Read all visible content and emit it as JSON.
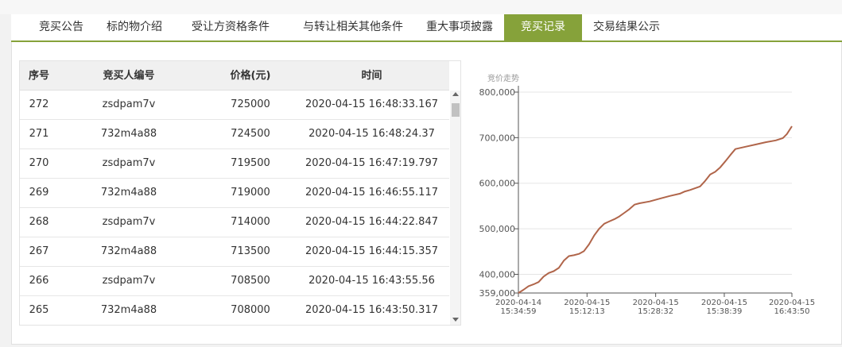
{
  "tabs": [
    {
      "label": "竞买公告",
      "active": false
    },
    {
      "label": "标的物介绍",
      "active": false
    },
    {
      "label": "受让方资格条件",
      "active": false
    },
    {
      "label": "与转让相关其他条件",
      "active": false
    },
    {
      "label": "重大事项披露",
      "active": false
    },
    {
      "label": "竞买记录",
      "active": true
    },
    {
      "label": "交易结果公示",
      "active": false
    }
  ],
  "table": {
    "headers": [
      "序号",
      "竞买人编号",
      "价格(元)",
      "时间"
    ],
    "rows": [
      [
        "272",
        "zsdpam7v",
        "725000",
        "2020-04-15 16:48:33.167"
      ],
      [
        "271",
        "732m4a88",
        "724500",
        "2020-04-15 16:48:24.37"
      ],
      [
        "270",
        "zsdpam7v",
        "719500",
        "2020-04-15 16:47:19.797"
      ],
      [
        "269",
        "732m4a88",
        "719000",
        "2020-04-15 16:46:55.117"
      ],
      [
        "268",
        "zsdpam7v",
        "714000",
        "2020-04-15 16:44:22.847"
      ],
      [
        "267",
        "732m4a88",
        "713500",
        "2020-04-15 16:44:15.357"
      ],
      [
        "266",
        "zsdpam7v",
        "708500",
        "2020-04-15 16:43:55.56"
      ],
      [
        "265",
        "732m4a88",
        "708000",
        "2020-04-15 16:43:50.317"
      ]
    ]
  },
  "chart_data": {
    "type": "line",
    "title": "竞价走势",
    "ylim": [
      359000,
      800000
    ],
    "y_ticks": [
      "359,000",
      "400,000",
      "500,000",
      "600,000",
      "700,000",
      "800,000"
    ],
    "y_tick_values": [
      359000,
      400000,
      500000,
      600000,
      700000,
      800000
    ],
    "x_ticks": [
      {
        "line1": "2020-04-14",
        "line2": "15:34:59",
        "index": 0
      },
      {
        "line1": "2020-04-15",
        "line2": "15:12:13",
        "index": 68
      },
      {
        "line1": "2020-04-15",
        "line2": "15:28:32",
        "index": 136
      },
      {
        "line1": "2020-04-15",
        "line2": "15:38:39",
        "index": 204
      },
      {
        "line1": "2020-04-15",
        "line2": "16:43:50",
        "index": 271
      }
    ],
    "series": [
      {
        "color": "#b0654a",
        "points": [
          [
            0,
            359000
          ],
          [
            5,
            366000
          ],
          [
            10,
            374000
          ],
          [
            15,
            378000
          ],
          [
            20,
            383000
          ],
          [
            25,
            395000
          ],
          [
            30,
            403000
          ],
          [
            35,
            407000
          ],
          [
            40,
            414000
          ],
          [
            45,
            430000
          ],
          [
            50,
            440000
          ],
          [
            55,
            442000
          ],
          [
            60,
            445000
          ],
          [
            65,
            451000
          ],
          [
            70,
            466000
          ],
          [
            75,
            485000
          ],
          [
            80,
            500000
          ],
          [
            85,
            511000
          ],
          [
            90,
            516000
          ],
          [
            95,
            521000
          ],
          [
            100,
            527000
          ],
          [
            105,
            535000
          ],
          [
            110,
            543000
          ],
          [
            115,
            553000
          ],
          [
            120,
            556000
          ],
          [
            130,
            560000
          ],
          [
            140,
            566000
          ],
          [
            150,
            572000
          ],
          [
            160,
            577000
          ],
          [
            165,
            582000
          ],
          [
            170,
            585000
          ],
          [
            180,
            593000
          ],
          [
            185,
            605000
          ],
          [
            190,
            619000
          ],
          [
            195,
            625000
          ],
          [
            200,
            635000
          ],
          [
            205,
            648000
          ],
          [
            210,
            662000
          ],
          [
            215,
            675000
          ],
          [
            225,
            680000
          ],
          [
            235,
            685000
          ],
          [
            245,
            690000
          ],
          [
            255,
            694000
          ],
          [
            262,
            699000
          ],
          [
            266,
            708000
          ],
          [
            271,
            725000
          ]
        ]
      }
    ]
  }
}
